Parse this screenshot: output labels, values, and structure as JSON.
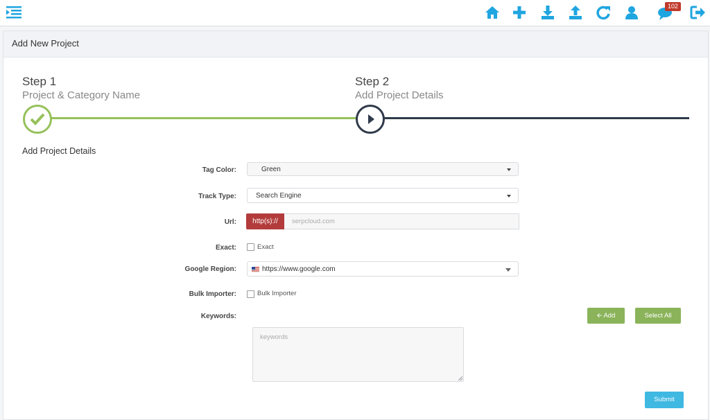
{
  "topbar": {
    "notification_count": "102",
    "icons": [
      "menu-icon",
      "home-icon",
      "plus-icon",
      "download-icon",
      "upload-icon",
      "refresh-icon",
      "user-icon",
      "chat-icon",
      "logout-icon"
    ]
  },
  "panel": {
    "title": "Add New Project"
  },
  "steps": [
    {
      "label": "Step 1",
      "subtitle": "Project & Category Name",
      "status": "done"
    },
    {
      "label": "Step 2",
      "subtitle": "Add Project Details",
      "status": "current"
    }
  ],
  "form": {
    "section_title": "Add Project Details",
    "tag_color": {
      "label": "Tag Color:",
      "value": "Green"
    },
    "track_type": {
      "label": "Track Type:",
      "value": "Search Engine"
    },
    "url": {
      "label": "Url:",
      "prefix": "http(s)://",
      "placeholder": "serpcloud.com"
    },
    "exact": {
      "label": "Exact:",
      "checkbox_label": "Exact"
    },
    "google_region": {
      "label": "Google Region:",
      "value": "https://www.google.com"
    },
    "bulk_importer": {
      "label": "Bulk Importer:",
      "checkbox_label": "Bulk Importer"
    },
    "keywords": {
      "label": "Keywords:",
      "placeholder": "keywords"
    },
    "add_button": "Add",
    "select_all_button": "Select All",
    "submit_button": "Submit"
  },
  "colors": {
    "accent": "#1fa5e0",
    "done": "#95c15a",
    "current": "#2f3a4a",
    "url_addon": "#b33b3b",
    "green_btn": "#8ab35a",
    "blue_btn": "#3fb8e2"
  }
}
